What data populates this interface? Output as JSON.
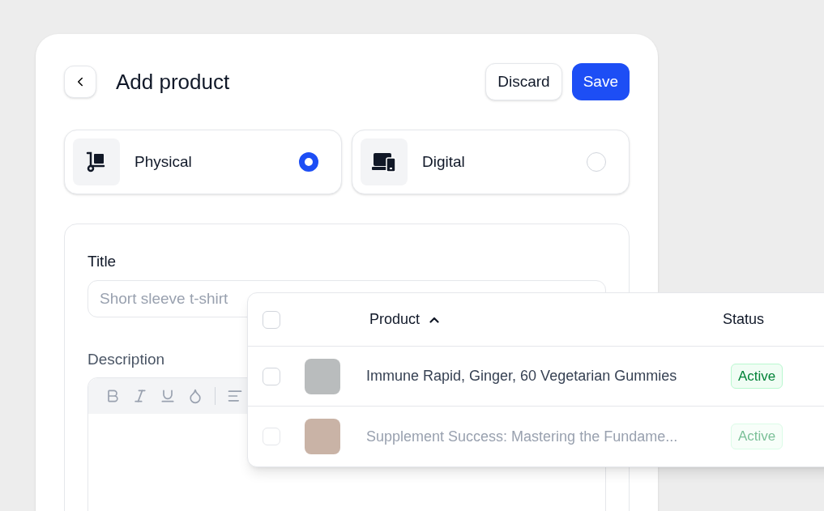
{
  "header": {
    "title": "Add product",
    "buttons": [
      {
        "label": "Discard",
        "kind": "secondary"
      },
      {
        "label": "Save",
        "kind": "primary"
      }
    ]
  },
  "product_types": [
    {
      "label": "Physical",
      "kind": "physical",
      "selected": true
    },
    {
      "label": "Digital",
      "kind": "digital",
      "selected": false
    }
  ],
  "form": {
    "title_label": "Title",
    "title_placeholder": "Short sleeve t-shirt",
    "description_label": "Description"
  },
  "table": {
    "columns": [
      "Product",
      "Status"
    ],
    "header_checked": false,
    "rows": [
      {
        "product": "Immune Rapid, Ginger, 60 Vegetarian Gummies",
        "status": "Active",
        "checked": false,
        "faded": false
      },
      {
        "product": "Supplement Success: Mastering the Fundame...",
        "status": "Active",
        "checked": false,
        "faded": true
      }
    ]
  }
}
